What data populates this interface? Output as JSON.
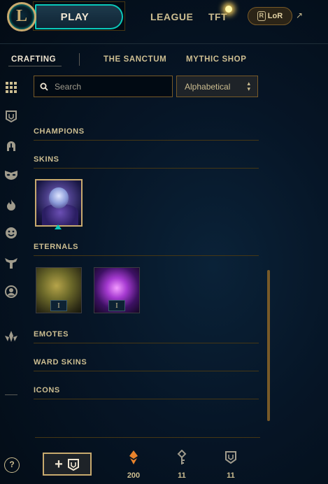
{
  "header": {
    "logo_letter": "L",
    "play_label": "PLAY",
    "nav": [
      "LEAGUE",
      "TFT"
    ],
    "lor_label": "LoR",
    "external_arrow": "↗"
  },
  "subnav": {
    "tabs": [
      "CRAFTING",
      "THE SANCTUM",
      "MYTHIC SHOP"
    ],
    "active": "CRAFTING"
  },
  "rail": {
    "icons": [
      "grid-icon",
      "chest-icon",
      "helmet-icon",
      "mask-icon",
      "flame-icon",
      "emote-face-icon",
      "ward-icon",
      "profile-icon",
      "mythic-essence-icon"
    ]
  },
  "filters": {
    "search_placeholder": "Search",
    "search_value": "",
    "sort_value": "Alphabetical"
  },
  "sections": {
    "champions": "CHAMPIONS",
    "skins": "SKINS",
    "eternals": "ETERNALS",
    "emotes": "EMOTES",
    "ward_skins": "WARD SKINS",
    "icons": "ICONS"
  },
  "eternals": [
    {
      "badge": "I"
    },
    {
      "badge": "I"
    }
  ],
  "footer": {
    "help_label": "?",
    "add_label": "+",
    "orange_essence": "200",
    "keys": "11",
    "chests": "11"
  },
  "colors": {
    "gold": "#c8aa6e",
    "gold_text": "#cdbe91",
    "teal": "#0ac8b9",
    "background": "#030b14",
    "orange_essence": "#e8832c"
  }
}
